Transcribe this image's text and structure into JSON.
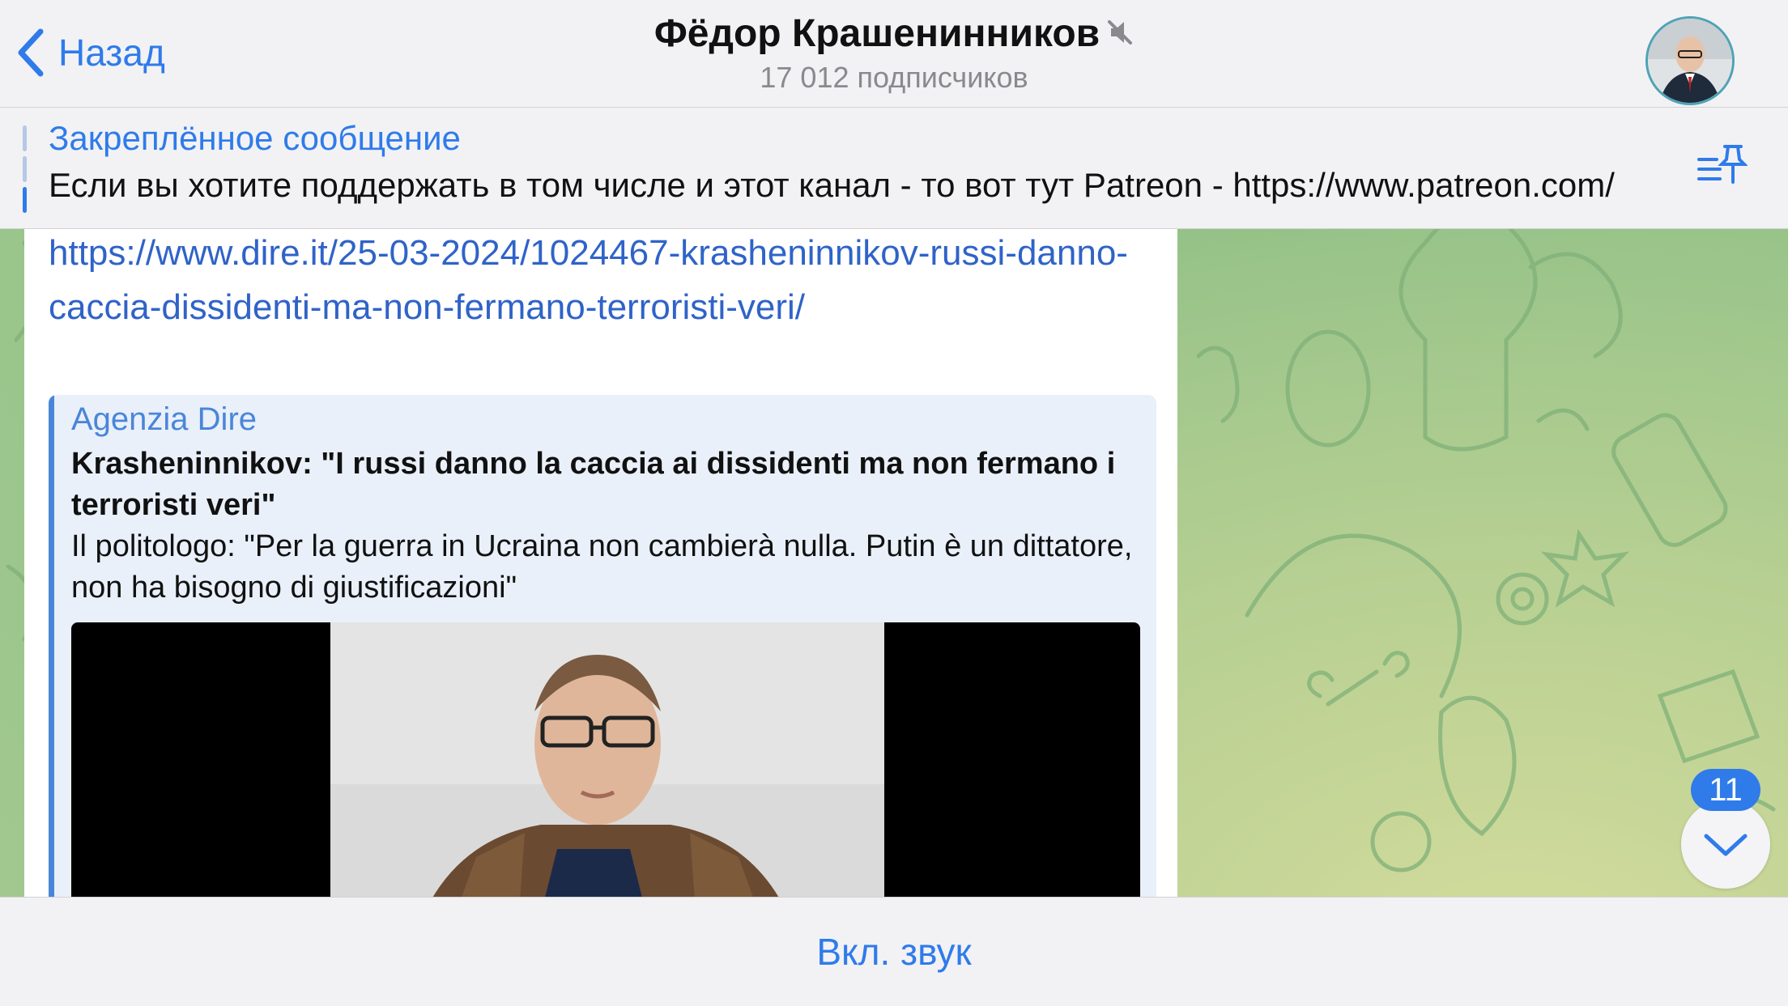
{
  "header": {
    "back_label": "Назад",
    "channel_name": "Фёдор Крашенинников",
    "subscribers": "17 012 подписчиков"
  },
  "pinned": {
    "title": "Закреплённое сообщение",
    "text": "Если вы хотите поддержать в том числе и этот канал - то вот тут Patreon - https://www.patreon.com/"
  },
  "message": {
    "link": "https://www.dire.it/25-03-2024/1024467-krasheninnikov-russi-danno-caccia-dissidenti-ma-non-fermano-terroristi-veri/",
    "preview": {
      "site_name": "Agenzia Dire",
      "title": "Krasheninnikov: \"I russi danno la caccia ai dissidenti ma non fermano i terroristi veri\"",
      "description": "Il politologo: \"Per la guerra in Ucraina non cambierà nulla. Putin è un dittatore, non ha bisogno di giustificazioni\""
    }
  },
  "scroll_down": {
    "unread_count": "11"
  },
  "bottom": {
    "unmute_label": "Вкл. звук"
  },
  "colors": {
    "accent": "#2f7bea",
    "link": "#2f63c8",
    "preview_accent": "#4a86d8",
    "wallpaper": "#9cc48f"
  },
  "icons": [
    "chevron-left-icon",
    "muted-speaker-icon",
    "pin-list-icon",
    "chevron-down-icon"
  ]
}
